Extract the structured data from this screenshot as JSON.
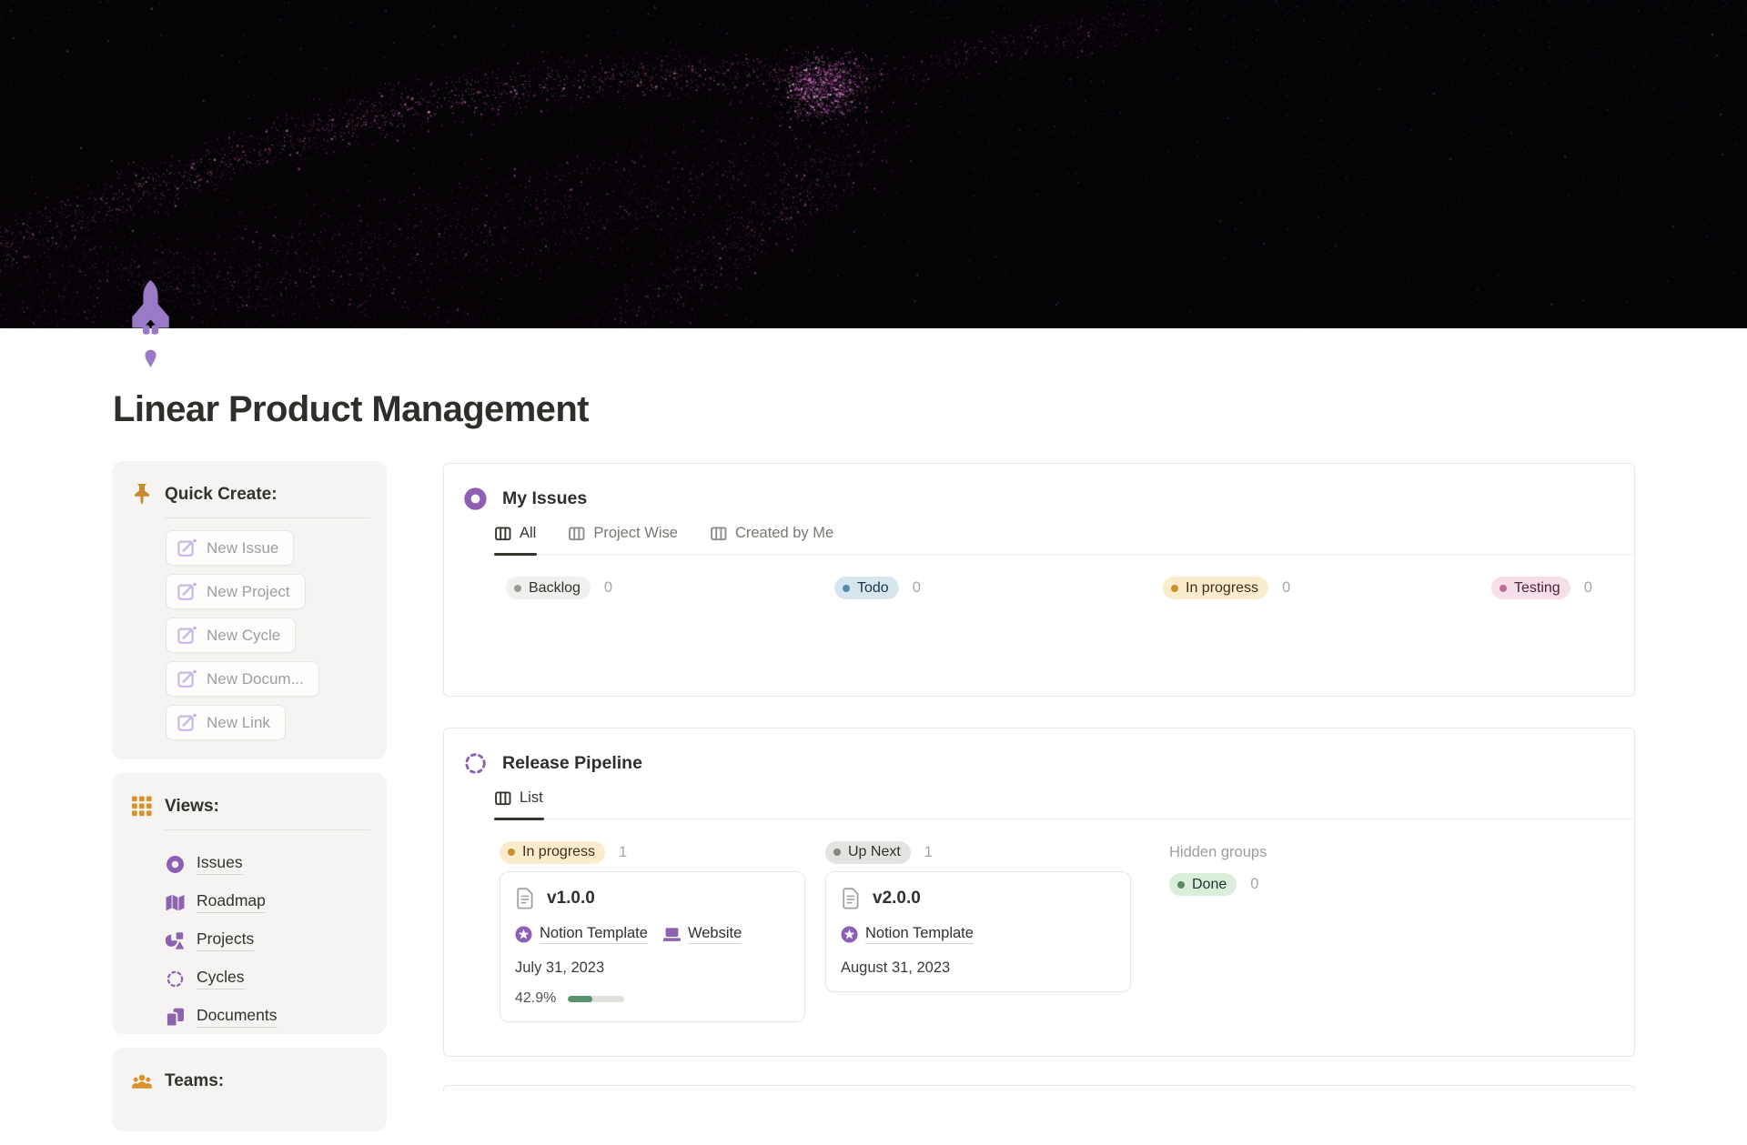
{
  "page": {
    "title": "Linear Product Management",
    "icon": "rocket-icon"
  },
  "banner": {
    "background": "#060306",
    "nebula_palette": [
      "#e27fd8",
      "#c44fc0",
      "#a13b9c",
      "#7c2f7e",
      "#551f5c",
      "#ef9ae2"
    ],
    "star_colors": [
      "#c9c9d4",
      "#8ea2e0",
      "#9fb48f",
      "#ffffff"
    ]
  },
  "sidebar": {
    "quick_create": {
      "heading": "Quick Create:",
      "icon": "pushpin-icon",
      "buttons": [
        {
          "label": "New Issue",
          "icon": "compose-icon"
        },
        {
          "label": "New Project",
          "icon": "compose-icon"
        },
        {
          "label": "New Cycle",
          "icon": "compose-icon"
        },
        {
          "label": "New Docum...",
          "icon": "compose-icon"
        },
        {
          "label": "New Link",
          "icon": "compose-icon"
        }
      ]
    },
    "views": {
      "heading": "Views:",
      "icon": "grid-icon",
      "items": [
        {
          "label": "Issues",
          "icon": "donut-icon"
        },
        {
          "label": "Roadmap",
          "icon": "map-icon"
        },
        {
          "label": "Projects",
          "icon": "shapes-icon"
        },
        {
          "label": "Cycles",
          "icon": "dashed-circle-icon"
        },
        {
          "label": "Documents",
          "icon": "documents-icon"
        }
      ]
    },
    "teams": {
      "heading": "Teams:",
      "icon": "people-icon"
    }
  },
  "my_issues": {
    "title": "My Issues",
    "icon": "donut-icon",
    "tabs": [
      {
        "label": "All",
        "active": true
      },
      {
        "label": "Project Wise",
        "active": false
      },
      {
        "label": "Created by Me",
        "active": false
      }
    ],
    "groups": [
      {
        "label": "Backlog",
        "count": "0",
        "color": "#f1f0ef",
        "dot": "#9a9996"
      },
      {
        "label": "Todo",
        "count": "0",
        "color": "#d7e5ee",
        "dot": "#528bad"
      },
      {
        "label": "In progress",
        "count": "0",
        "color": "#fbedcc",
        "dot": "#c98f2b"
      },
      {
        "label": "Testing",
        "count": "0",
        "color": "#f6dfe9",
        "dot": "#c06a97"
      }
    ]
  },
  "release_pipeline": {
    "title": "Release Pipeline",
    "icon": "dashed-circle-icon",
    "tabs": [
      {
        "label": "List",
        "active": true
      }
    ],
    "columns": [
      {
        "group": {
          "label": "In progress",
          "count": "1",
          "color": "#fbedcc",
          "dot": "#c98f2b"
        },
        "cards": [
          {
            "title": "v1.0.0",
            "icon": "page-icon",
            "tags": [
              {
                "label": "Notion Template",
                "icon": "star-badge-icon"
              },
              {
                "label": "Website",
                "icon": "laptop-icon"
              }
            ],
            "date": "July 31, 2023",
            "progress_label": "42.9%",
            "progress_pct": 42.9,
            "progress_color": "#57916e"
          }
        ]
      },
      {
        "group": {
          "label": "Up Next",
          "count": "1",
          "color": "#e4e3e1",
          "dot": "#85847f"
        },
        "cards": [
          {
            "title": "v2.0.0",
            "icon": "page-icon",
            "tags": [
              {
                "label": "Notion Template",
                "icon": "star-badge-icon"
              }
            ],
            "date": "August 31, 2023"
          }
        ]
      },
      {
        "hidden_label": "Hidden groups",
        "group": {
          "label": "Done",
          "count": "0",
          "color": "#dbeddb",
          "dot": "#578a63"
        }
      }
    ]
  },
  "colors": {
    "accent_purple": "#8d5fb5",
    "icon_orange": "#c98a2c",
    "rocket_purple": "#9a79c7",
    "card_border": "#e9e8e6",
    "sidebar_bg": "#f5f4f3",
    "active_tab": "#37352f",
    "inactive_tab": "#79776f"
  }
}
